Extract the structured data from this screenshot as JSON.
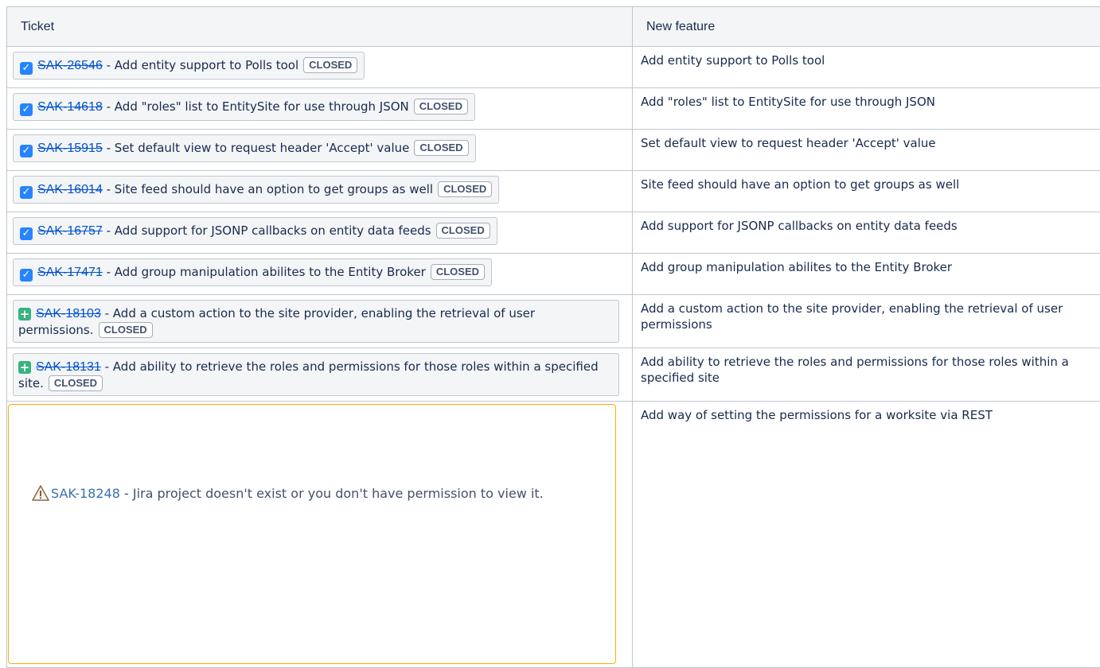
{
  "headers": {
    "ticket": "Ticket",
    "feature": "New feature"
  },
  "status_label": "CLOSED",
  "rows": [
    {
      "key": "SAK-26546",
      "summary": "Add entity support to Polls tool",
      "feature": "Add entity support to Polls tool",
      "type_icon": "checkbox-icon"
    },
    {
      "key": "SAK-14618",
      "summary": "Add \"roles\" list to EntitySite for use through JSON",
      "feature": "Add \"roles\" list to EntitySite for use through JSON",
      "type_icon": "checkbox-icon"
    },
    {
      "key": "SAK-15915",
      "summary": "Set default view to request header 'Accept' value",
      "feature": "Set default view to request header 'Accept' value",
      "type_icon": "checkbox-icon"
    },
    {
      "key": "SAK-16014",
      "summary": "Site feed should have an option to get groups as well",
      "feature": "Site feed should have an option to get groups as well",
      "type_icon": "checkbox-icon"
    },
    {
      "key": "SAK-16757",
      "summary": "Add support for JSONP callbacks on entity data feeds",
      "feature": "Add support for JSONP callbacks on entity data feeds",
      "type_icon": "checkbox-icon"
    },
    {
      "key": "SAK-17471",
      "summary": "Add group manipulation abilites to the Entity Broker",
      "feature": "Add group manipulation abilites to the Entity Broker",
      "type_icon": "checkbox-icon"
    },
    {
      "key": "SAK-18103",
      "summary": "Add a custom action to the site provider, enabling the retrieval of user permissions.",
      "feature": "Add a custom action to the site provider, enabling the retrieval of user permissions",
      "type_icon": "plus-icon"
    },
    {
      "key": "SAK-18131",
      "summary": "Add ability to retrieve the roles and permissions for those roles within a specified site.",
      "feature": "Add ability to retrieve the roles and permissions for those roles within a specified site",
      "type_icon": "plus-icon"
    }
  ],
  "warning_row": {
    "key": "SAK-18248",
    "message": "Jira project doesn't exist or you don't have permission to view it.",
    "feature": "Add way of setting the permissions for a worksite via REST",
    "icon": "warning-icon"
  },
  "colors": {
    "link": "#0052cc",
    "check": "#2684ff",
    "plus": "#36b37e",
    "warning_border": "#ffab00",
    "header_bg": "#f4f5f7"
  }
}
